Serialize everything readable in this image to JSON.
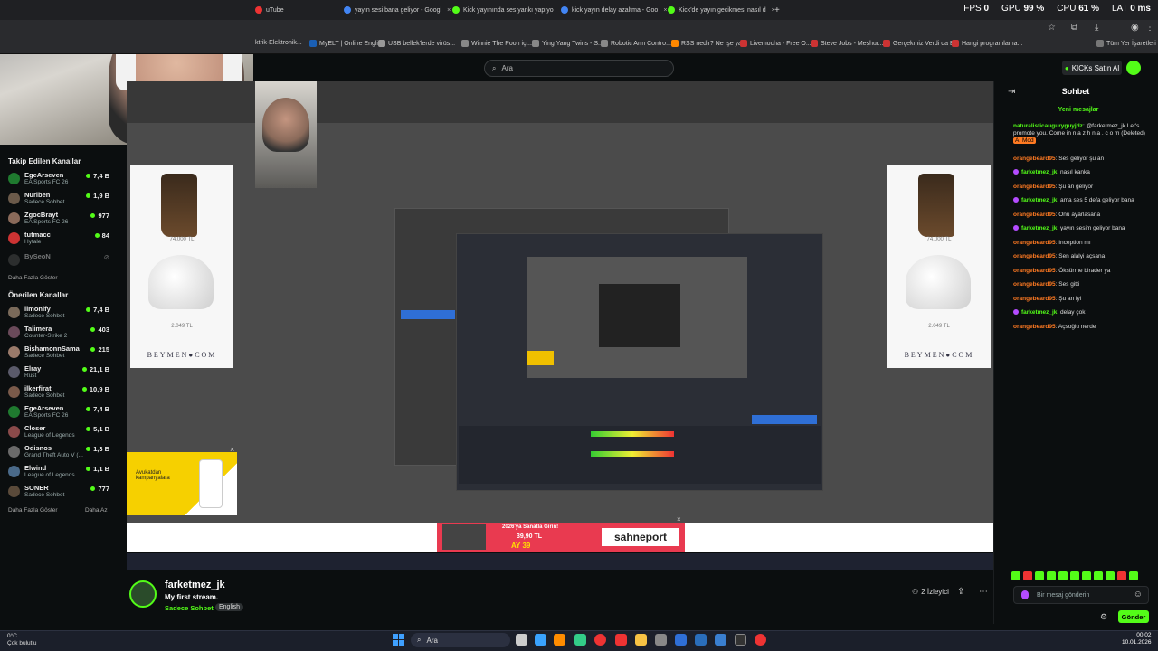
{
  "browser": {
    "tabs": [
      {
        "label": "uTube",
        "color": "#e33"
      },
      {
        "label": "yayın sesi bana geliyor - Googl",
        "color": "#4285f4"
      },
      {
        "label": "Kick yayınında ses yankı yapıyo",
        "color": "#53fc18"
      },
      {
        "label": "kick yayın delay azaltma - Goo",
        "color": "#4285f4"
      },
      {
        "label": "Kick'de yayın gecikmesi nasıl d",
        "color": "#53fc18"
      }
    ],
    "new_tab": "+",
    "perf": {
      "fps_label": "FPS",
      "fps": "0",
      "gpu_label": "GPU",
      "gpu": "99 %",
      "cpu_label": "CPU",
      "cpu": "61 %",
      "lat_label": "LAT",
      "lat": "0 ms"
    },
    "bookmarks": [
      "ktrik-Elektronik...",
      "MyELT | Online Engli...",
      "USB bellek'lerde virüs...",
      "Winnie The Pooh içi...",
      "Ying Yang Twins - S...",
      "Robotic Arm Contro...",
      "RSS nedir? Ne işe ya...",
      "Livemocha - Free O...",
      "Steve Jobs - Meşhur...",
      "Gerçekmiz Verdi da B...",
      "Hangi programlama..."
    ],
    "all_bookmarks": "Tüm Yer İşaretleri"
  },
  "kick": {
    "search_placeholder": "Ara",
    "buy_kicks": "KICKs Satın Al"
  },
  "sidebar": {
    "followed_title": "Takip Edilen Kanallar",
    "followed": [
      {
        "name": "EgeArseven",
        "category": "EA Sports FC 26",
        "viewers": "7,4 B",
        "color": "#1f7a2f"
      },
      {
        "name": "Nuriben",
        "category": "Sadece Sohbet",
        "viewers": "1,9 B",
        "color": "#6b5a4a"
      },
      {
        "name": "ZgocBrayt",
        "category": "EA Sports FC 26",
        "viewers": "977",
        "color": "#8a6a5a"
      },
      {
        "name": "tutmacc",
        "category": "Hytale",
        "viewers": "84",
        "color": "#c33"
      },
      {
        "name": "BySeoN",
        "category": "",
        "viewers": "",
        "color": "#555"
      }
    ],
    "show_more_1": "Daha Fazla Göster",
    "recommended_title": "Önerilen Kanallar",
    "recommended": [
      {
        "name": "limonify",
        "category": "Sadece Sohbet",
        "viewers": "7,4 B",
        "color": "#7a6a5a"
      },
      {
        "name": "Talimera",
        "category": "Counter-Strike 2",
        "viewers": "403",
        "color": "#6a4a5a"
      },
      {
        "name": "BishamonnSama",
        "category": "Sadece Sohbet",
        "viewers": "215",
        "color": "#9a7a6a"
      },
      {
        "name": "Elray",
        "category": "Rust",
        "viewers": "21,1 B",
        "color": "#5a5a6a"
      },
      {
        "name": "ilkerfirat",
        "category": "Sadece Sohbet",
        "viewers": "10,9 B",
        "color": "#7a5a4a"
      },
      {
        "name": "EgeArseven",
        "category": "EA Sports FC 26",
        "viewers": "7,4 B",
        "color": "#1f7a2f"
      },
      {
        "name": "Closer",
        "category": "League of Legends",
        "viewers": "5,1 B",
        "color": "#8a4a4a"
      },
      {
        "name": "Odisnos",
        "category": "Grand Theft Auto V (...",
        "viewers": "1,3 B",
        "color": "#6a6a6a"
      },
      {
        "name": "Elwind",
        "category": "League of Legends",
        "viewers": "1,1 B",
        "color": "#4a6a8a"
      },
      {
        "name": "SONER",
        "category": "Sadece Sohbet",
        "viewers": "777",
        "color": "#5a4a3a"
      }
    ],
    "show_more_2": "Daha Fazla Göster",
    "show_less": "Daha Az"
  },
  "video": {
    "ad_price_1": "74.000 TL",
    "ad_price_2": "2.049 TL",
    "ad_brand": "BEYMEN●COM",
    "banner_text": "sahneport",
    "banner_promo": "2026'ya Sanatla Girin!",
    "banner_price": "39,90 TL",
    "banner_months": "AY 39",
    "small_ad_text": "Avukatdan kampanyalara",
    "close": "×"
  },
  "stream": {
    "streamer": "farketmez_jk",
    "title": "My first stream.",
    "category": "Sadece Sohbet",
    "language": "English",
    "viewers": "2 İzleyici"
  },
  "chat": {
    "title": "Sohbet",
    "new_messages": "Yeni mesajlar",
    "messages": [
      {
        "user": "naturalisticauguryguyjdz",
        "cls": "u-green",
        "text": "@farketmez_jk Let's promote you. Come in n a z h n a . c o m (Deleted)",
        "badge": false,
        "ai": "AI Mod"
      },
      {
        "user": "orangebeard95",
        "cls": "u-orange",
        "text": "Ses geliyor şu an",
        "badge": false
      },
      {
        "user": "farketmez_jk",
        "cls": "u-green",
        "text": "nasıl kanka",
        "badge": true
      },
      {
        "user": "orangebeard95",
        "cls": "u-orange",
        "text": "Şu an geliyor",
        "badge": false
      },
      {
        "user": "farketmez_jk",
        "cls": "u-green",
        "text": "ama ses 5 defa geliyor bana",
        "badge": true
      },
      {
        "user": "orangebeard95",
        "cls": "u-orange",
        "text": "Onu ayarlasana",
        "badge": false
      },
      {
        "user": "farketmez_jk",
        "cls": "u-green",
        "text": "yayın sesim geliyor bana",
        "badge": true
      },
      {
        "user": "orangebeard95",
        "cls": "u-orange",
        "text": "Inception mı",
        "badge": false
      },
      {
        "user": "orangebeard95",
        "cls": "u-orange",
        "text": "Sen alalyi açsana",
        "badge": false
      },
      {
        "user": "orangebeard95",
        "cls": "u-orange",
        "text": "Öksürme birader ya",
        "badge": false
      },
      {
        "user": "orangebeard95",
        "cls": "u-orange",
        "text": "Ses gitti",
        "badge": false
      },
      {
        "user": "orangebeard95",
        "cls": "u-orange",
        "text": "Şu an iyi",
        "badge": false
      },
      {
        "user": "farketmez_jk",
        "cls": "u-green",
        "text": "delay çok",
        "badge": true
      },
      {
        "user": "orangebeard95",
        "cls": "u-orange",
        "text": "Açsoğlu nerde",
        "badge": false
      }
    ],
    "input_placeholder": "Bir mesaj gönderin",
    "send": "Gönder"
  },
  "taskbar": {
    "weather_temp": "0°C",
    "weather_desc": "Çok bulutlu",
    "search": "Ara",
    "time": "00:02",
    "date": "10.01.2026"
  }
}
